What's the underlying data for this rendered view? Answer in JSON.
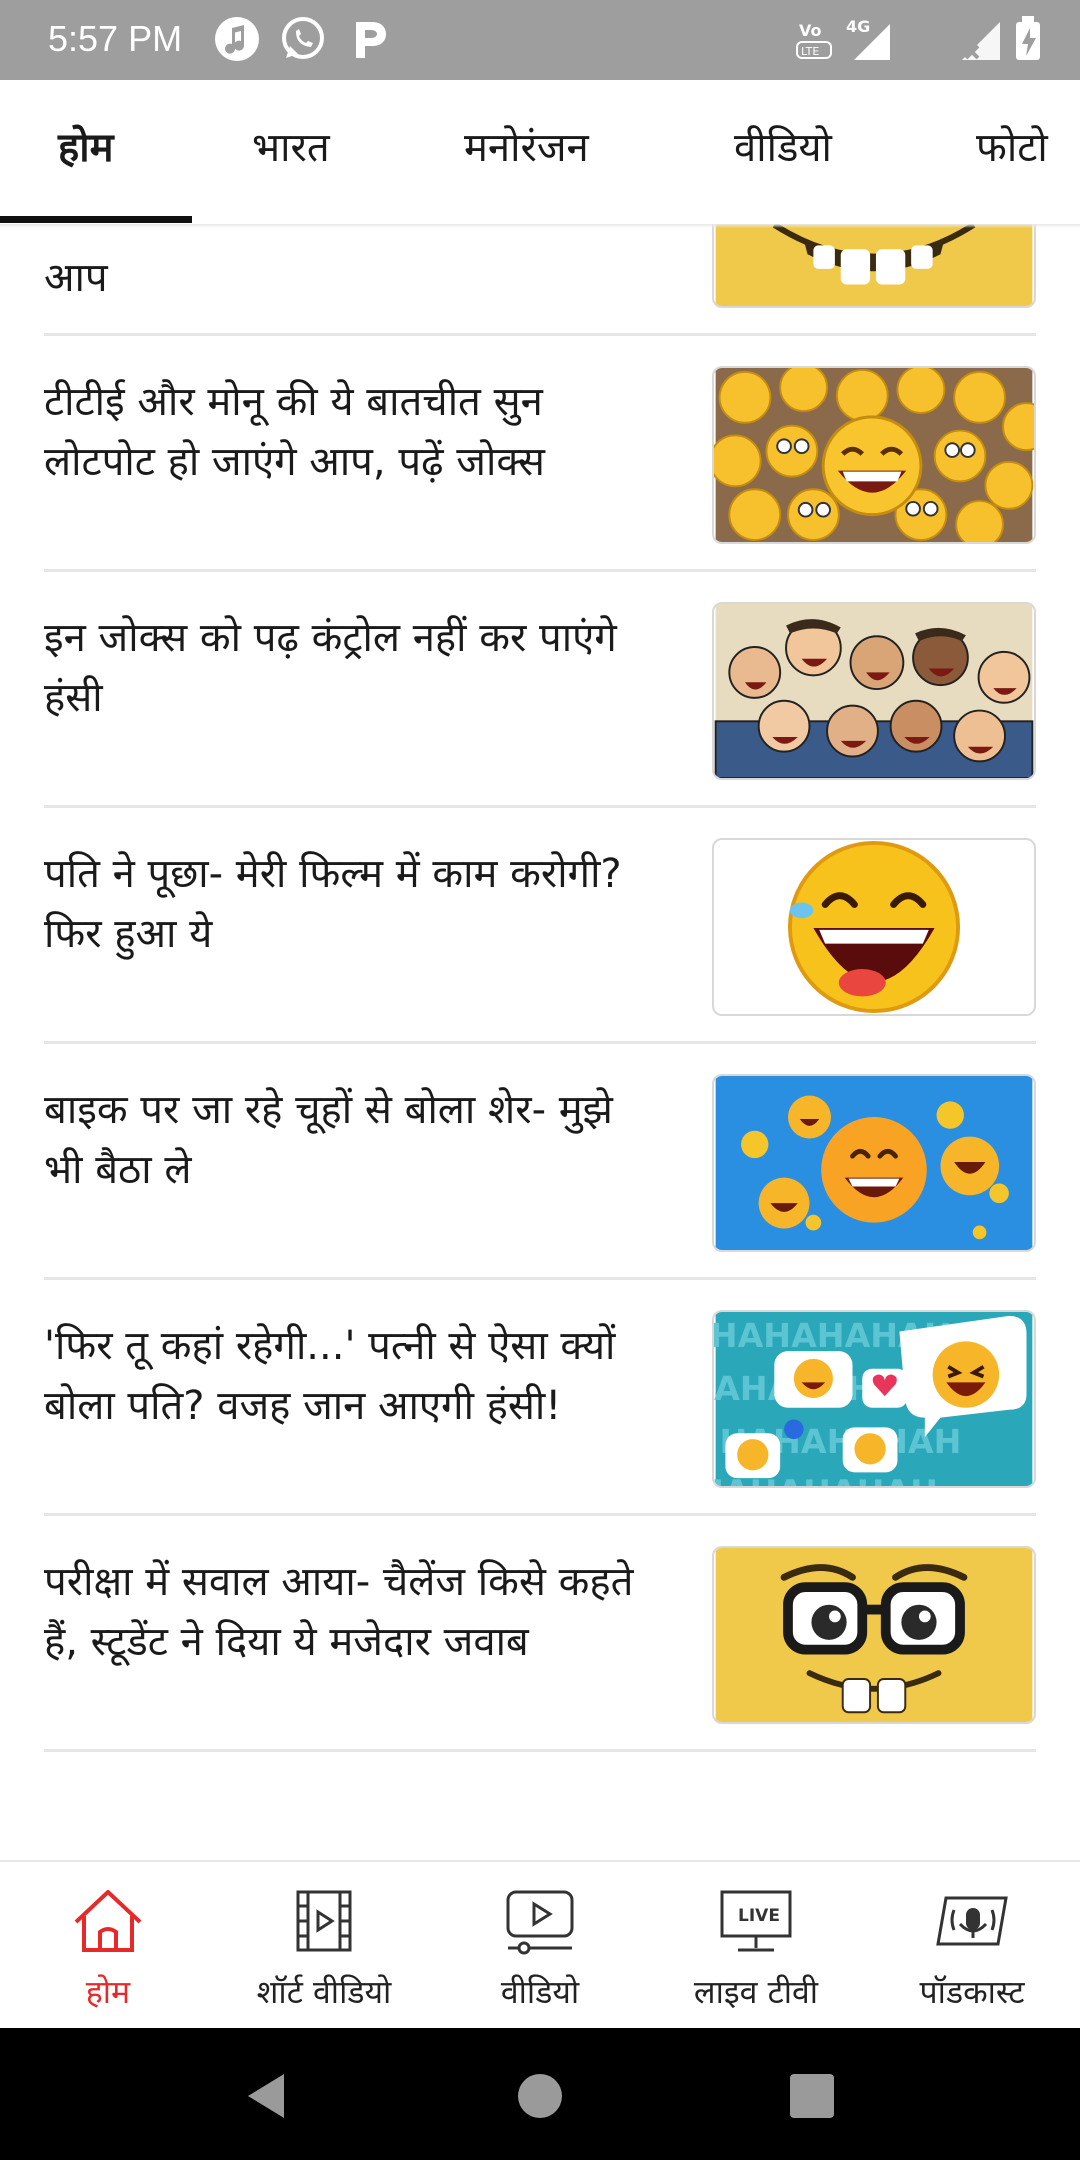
{
  "status_bar": {
    "time": "5:57 PM",
    "volte": "Vo LTE",
    "network": "4G"
  },
  "tabs": [
    {
      "label": "होम",
      "active": true
    },
    {
      "label": "भारत",
      "active": false
    },
    {
      "label": "मनोरंजन",
      "active": false
    },
    {
      "label": "वीडियो",
      "active": false
    },
    {
      "label": "फोटो",
      "active": false
    }
  ],
  "articles": [
    {
      "headline": "आप",
      "image": "glasses-smiley"
    },
    {
      "headline": "टीटीई और मोनू की ये बातचीत सुन लोटपोट हो जाएंगे आप, पढ़ें जोक्स",
      "image": "emoji-pile"
    },
    {
      "headline": "इन जोक्स को पढ़ कंट्रोल नहीं कर पाएंगे हंसी",
      "image": "laughing-people"
    },
    {
      "headline": "पति ने पूछा- मेरी फिल्म में काम करोगी? फिर हुआ ये",
      "image": "laughing-emoji"
    },
    {
      "headline": "बाइक पर जा रहे चूहों से बोला शेर- मुझे भी बैठा ले",
      "image": "smiley-bubbles"
    },
    {
      "headline": "'फिर तू कहां रहेगी...' पत्नी से ऐसा क्यों बोला पति? वजह जान आएगी हंसी!",
      "image": "hahaha-chat"
    },
    {
      "headline": "परीक्षा में सवाल आया- चैलेंज किसे कहते हैं, स्टूडेंट ने दिया ये मजेदार जवाब",
      "image": "glasses-smiley"
    }
  ],
  "thumb_text": {
    "hahaha": "HAHAHAHAH"
  },
  "bottom_nav": {
    "home": "होम",
    "short_video": "शॉर्ट वीडियो",
    "video": "वीडियो",
    "live_tv": "लाइव टीवी",
    "live_badge": "LIVE",
    "podcast": "पॉडकास्ट"
  },
  "colors": {
    "accent": "#e62a2a",
    "status_bar": "#9e9e9e",
    "divider": "#e6e6e6"
  }
}
